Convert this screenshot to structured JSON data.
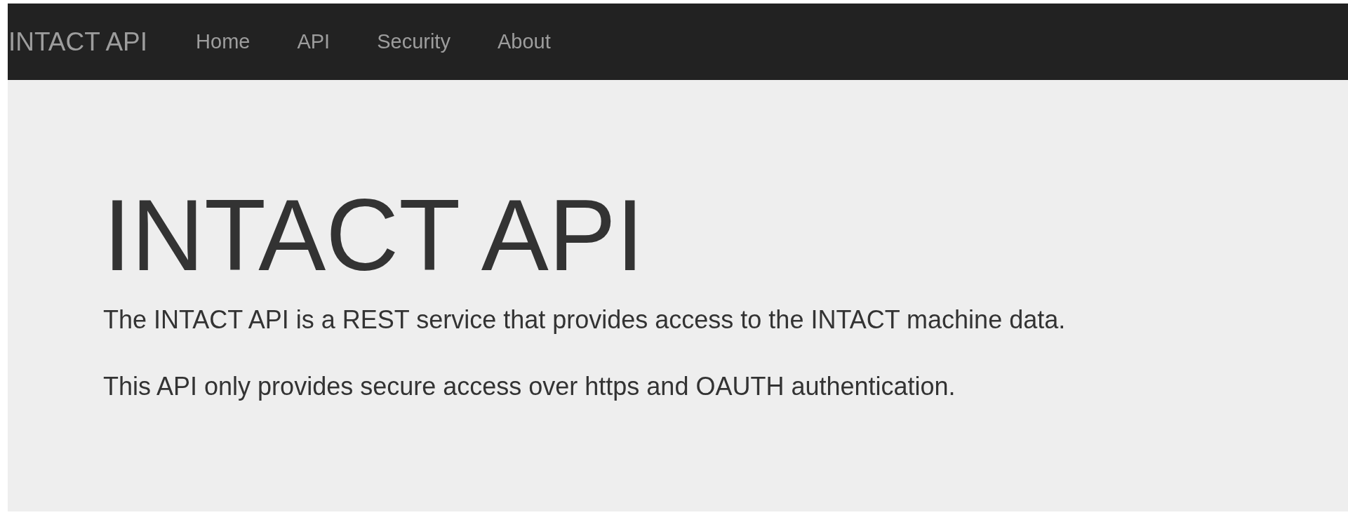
{
  "navbar": {
    "brand": "INTACT API",
    "items": [
      {
        "label": "Home"
      },
      {
        "label": "API"
      },
      {
        "label": "Security"
      },
      {
        "label": "About"
      }
    ]
  },
  "hero": {
    "title": "INTACT API",
    "paragraphs": [
      "The INTACT API is a REST service that provides access to the INTACT machine data.",
      "This API only provides secure access over https and OAUTH authentication."
    ]
  }
}
